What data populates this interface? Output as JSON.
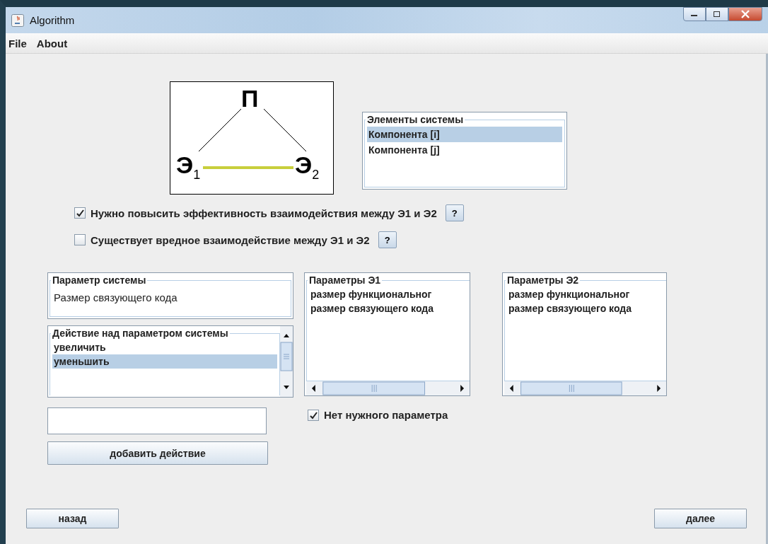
{
  "window": {
    "title": "Algorithm"
  },
  "menu": [
    "File",
    "About"
  ],
  "diagram": {
    "top": "П",
    "left": "Э$_{1}$",
    "right": "Э$_{2}$"
  },
  "elements": {
    "title": "Элементы системы",
    "items": [
      {
        "label": "Компонента [i]",
        "selected": true
      },
      {
        "label": "Компонента [j]",
        "selected": false
      }
    ]
  },
  "options": [
    {
      "label": "Нужно повысить эффективность взаимодействия между Э1 и Э2",
      "checked": true,
      "help": "?"
    },
    {
      "label": "Существует вредное взаимодействие между Э1 и Э2",
      "checked": false,
      "help": "?"
    }
  ],
  "system_parameter": {
    "title": "Параметр системы",
    "value": "Размер связующего кода"
  },
  "actions": {
    "title": "Действие над параметром системы",
    "items": [
      {
        "label": "увеличить",
        "selected": false
      },
      {
        "label": "уменьшить",
        "selected": true
      }
    ]
  },
  "add_button": "добавить действие",
  "params_e1": {
    "title": "Параметры Э1",
    "items": [
      "размер функциональног",
      "размер связующего кода"
    ]
  },
  "params_e2": {
    "title": "Параметры Э2",
    "items": [
      "размер функциональног",
      "размер связующего кода"
    ]
  },
  "no_param": {
    "label": "Нет нужного параметра",
    "checked": true
  },
  "buttons": {
    "back": "назад",
    "next": "далее"
  }
}
